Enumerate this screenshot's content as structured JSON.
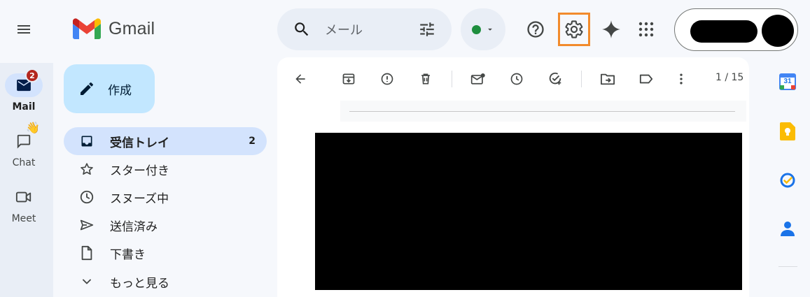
{
  "app": {
    "title": "Gmail"
  },
  "search": {
    "placeholder": "メール"
  },
  "status": {
    "color": "#1e8e3e"
  },
  "colors": {
    "accent": "#0b57d0",
    "compose_bg": "#c2e7ff",
    "active_bg": "#d3e3fd",
    "settings_highlight": "#f28b2c",
    "badge": "#b3261e"
  },
  "rail": [
    {
      "label": "Mail",
      "icon": "mail-icon",
      "badge": "2",
      "active": true
    },
    {
      "label": "Chat",
      "icon": "chat-icon",
      "emoji": "👋"
    },
    {
      "label": "Meet",
      "icon": "video-icon"
    }
  ],
  "compose": {
    "label": "作成"
  },
  "nav": [
    {
      "label": "受信トレイ",
      "count": "2",
      "icon": "inbox-icon",
      "active": true
    },
    {
      "label": "スター付き",
      "icon": "star-icon"
    },
    {
      "label": "スヌーズ中",
      "icon": "clock-icon"
    },
    {
      "label": "送信済み",
      "icon": "send-icon"
    },
    {
      "label": "下書き",
      "icon": "draft-icon"
    },
    {
      "label": "もっと見る",
      "icon": "chevron-down-icon"
    }
  ],
  "toolbar": {
    "pager": "1 / 15"
  },
  "side": {
    "calendar_day": "31",
    "icons": [
      "calendar-icon",
      "keep-icon",
      "tasks-icon",
      "contacts-icon"
    ]
  }
}
